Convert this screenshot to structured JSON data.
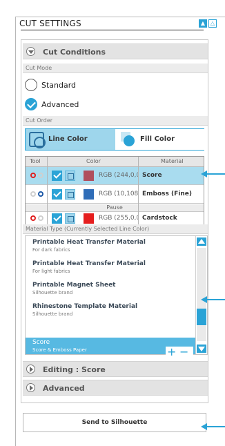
{
  "panel": {
    "title": "CUT SETTINGS",
    "btn_expand": "▲",
    "btn_collapse": "△"
  },
  "cut_conditions": {
    "label": "Cut Conditions",
    "cut_mode_label": "Cut Mode",
    "options": [
      "Standard",
      "Advanced"
    ],
    "selected": "Advanced",
    "cut_order_label": "Cut Order",
    "tabs": [
      "Line Color",
      "Fill Color"
    ],
    "active_tab": "Line Color"
  },
  "table": {
    "headers": [
      "Tool",
      "Color",
      "Material"
    ],
    "rows": [
      {
        "rgb": "RGB (244,0,0)",
        "material": "Score",
        "swatch": "#b04f5d",
        "tool1": "#e02020",
        "tool2": "#cfcfcf"
      },
      {
        "rgb": "RGB (10,108,255)",
        "material": "Emboss (Fine)",
        "swatch": "#2f6db8",
        "tool1": "#cfcfcf",
        "tool2": "#1f5aa8"
      },
      {
        "rgb": "RGB (255,0,0)",
        "material": "Cardstock",
        "swatch": "#e51e1e",
        "tool1": "#e02020",
        "tool2": "#cfcfcf"
      }
    ],
    "pause_label": "Pause"
  },
  "material_type": {
    "label": "Material Type (Currently Selected Line Color)",
    "items": [
      {
        "name": "Printable Heat Transfer Material",
        "desc": "For dark fabrics"
      },
      {
        "name": "Printable Heat Transfer Material",
        "desc": "For light fabrics"
      },
      {
        "name": "Printable Magnet Sheet",
        "desc": "Silhouette brand"
      },
      {
        "name": "Rhinestone Template Material",
        "desc": "Silhouette brand"
      },
      {
        "name": "Score",
        "desc": "Score & Emboss Paper"
      }
    ],
    "selected_index": 4,
    "add_label": "+",
    "remove_label": "−"
  },
  "editing": {
    "label": "Editing : Score"
  },
  "advanced": {
    "label": "Advanced"
  },
  "send_button": {
    "label": "Send to Silhouette"
  },
  "colors": {
    "accent": "#2aa3d6",
    "selected_row": "#a9dcef",
    "selected_item": "#57b9e2"
  }
}
